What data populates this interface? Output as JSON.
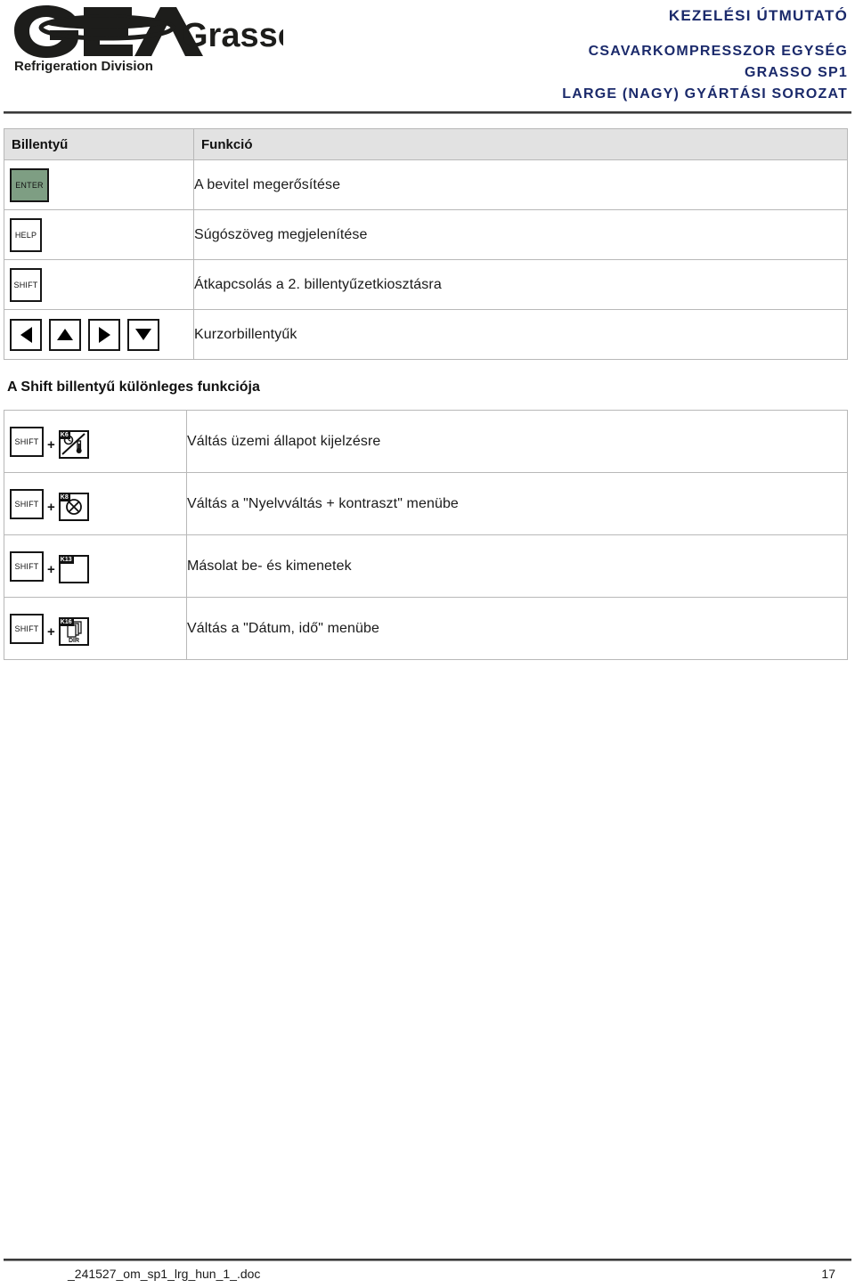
{
  "header": {
    "logo": {
      "brand": "GEA",
      "product": "Grasso",
      "tagline": "Refrigeration Division"
    },
    "title_main": "KEZELÉSI ÚTMUTATÓ",
    "title_lines": [
      "CSAVARKOMPRESSZOR EGYSÉG",
      "GRASSO SP1",
      "LARGE (NAGY) GYÁRTÁSI SOROZAT"
    ],
    "accent_color": "#1b2a6b"
  },
  "key_table": {
    "columns": {
      "key": "Billentyű",
      "function": "Funkció"
    },
    "rows": [
      {
        "key_labels": [
          "ENTER"
        ],
        "key_style": "enter-green",
        "key_color": "#7e9e83",
        "function": "A bevitel megerősítése"
      },
      {
        "key_labels": [
          "HELP"
        ],
        "key_style": "plain",
        "function": "Súgószöveg megjelenítése"
      },
      {
        "key_labels": [
          "SHIFT"
        ],
        "key_style": "plain",
        "function": "Átkapcsolás a 2. billentyűzetkiosztásra"
      },
      {
        "key_labels": [
          "arrow-left",
          "arrow-up",
          "arrow-right",
          "arrow-down"
        ],
        "key_style": "arrows",
        "function": "Kurzorbillentyűk"
      }
    ]
  },
  "shift_section": {
    "heading": "A Shift billentyű különleges funkciója",
    "modifier_label": "SHIFT",
    "combine_symbol": "+",
    "rows": [
      {
        "fkey_tag": "K6",
        "fkey_icon": "clock-thermometer-icon",
        "function": "Váltás üzemi állapot kijelzésre"
      },
      {
        "fkey_tag": "K8",
        "fkey_icon": "lamp-crossed-circle-icon",
        "function": "Váltás a \"Nyelvváltás + kontraszt\" menübe"
      },
      {
        "fkey_tag": "K13",
        "fkey_icon": "blank-icon",
        "function": "Másolat be- és kimenetek"
      },
      {
        "fkey_tag": "K16",
        "fkey_icon": "documents-dir-icon",
        "fkey_icon_label": "DIR",
        "function": "Váltás a \"Dátum, idő\" menübe"
      }
    ]
  },
  "footer": {
    "filename": "_241527_om_sp1_lrg_hun_1_.doc",
    "page_number": "17"
  }
}
